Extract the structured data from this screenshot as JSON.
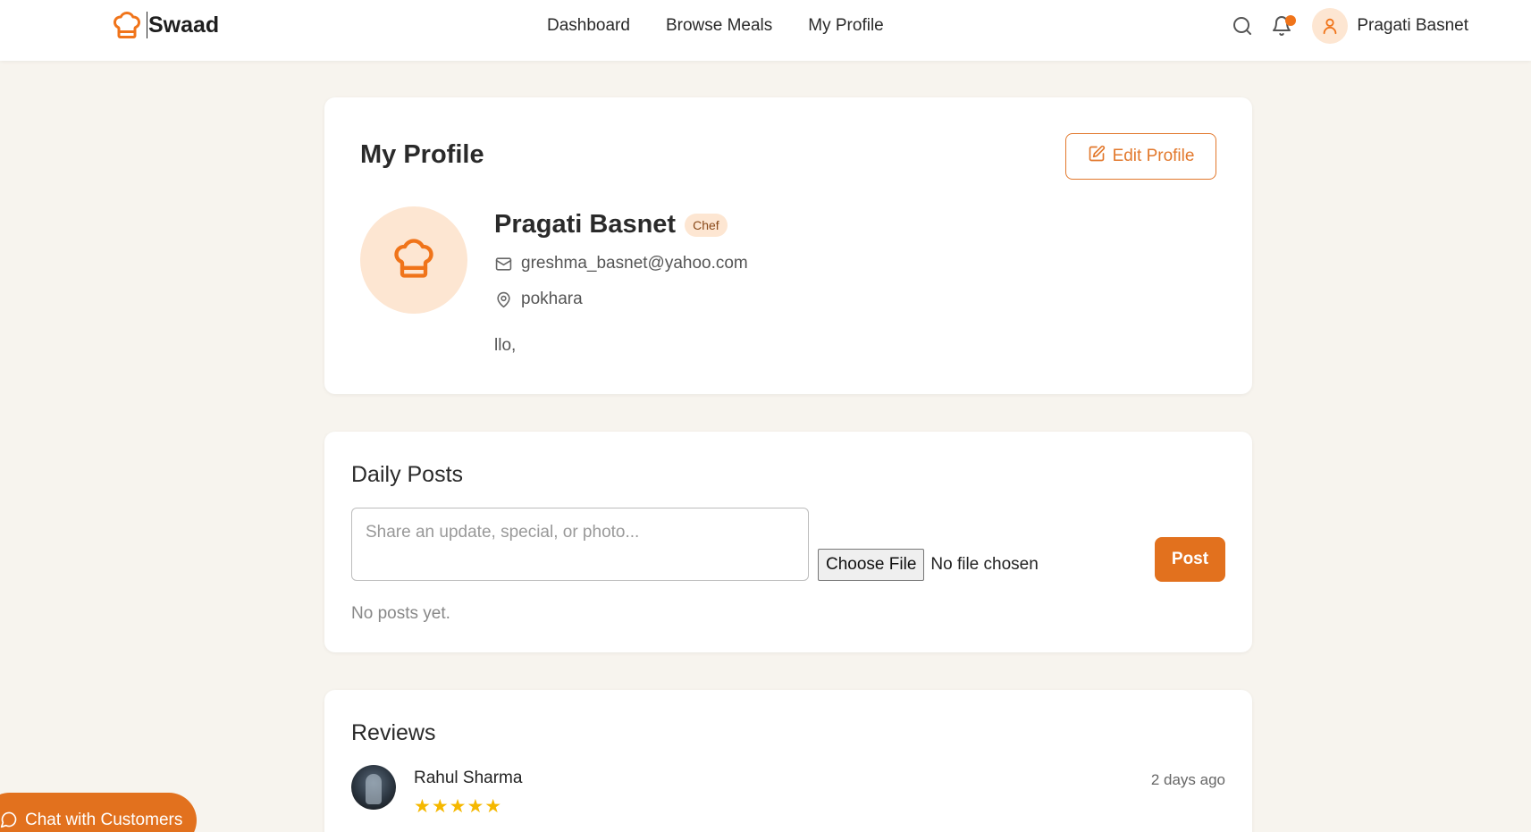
{
  "colors": {
    "accent": "#e2711e",
    "accent_light": "#fde6d2",
    "background": "#f7f4ee",
    "star": "#f5b800"
  },
  "header": {
    "brand": "Swaad",
    "nav": [
      {
        "label": "Dashboard"
      },
      {
        "label": "Browse Meals"
      },
      {
        "label": "My Profile"
      }
    ],
    "user_name": "Pragati Basnet",
    "icons": [
      "chef-hat-icon",
      "search-icon",
      "bell-icon",
      "user-icon"
    ]
  },
  "profile": {
    "title": "My Profile",
    "edit_label": "Edit Profile",
    "name": "Pragati Basnet",
    "role_badge": "Chef",
    "email": "greshma_basnet@yahoo.com",
    "location": "pokhara",
    "bio": "llo,"
  },
  "posts": {
    "title": "Daily Posts",
    "placeholder": "Share an update, special, or photo...",
    "file_button": "Choose File",
    "file_status": "No file chosen",
    "post_button": "Post",
    "empty_text": "No posts yet."
  },
  "reviews": {
    "title": "Reviews",
    "items": [
      {
        "author": "Rahul Sharma",
        "stars": "★★★★★",
        "rating": 5,
        "time": "2 days ago"
      }
    ]
  },
  "chat": {
    "label": "Chat with Customers"
  }
}
